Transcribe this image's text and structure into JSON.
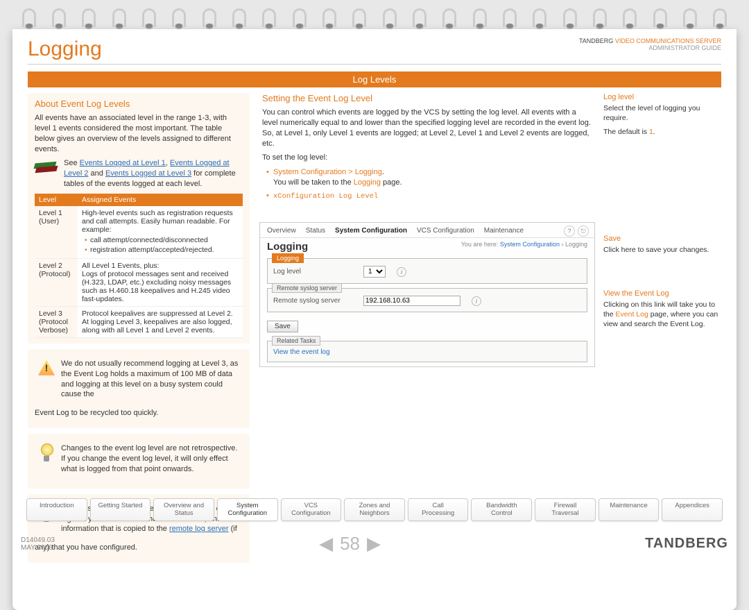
{
  "header": {
    "title": "Logging",
    "brand": "TANDBERG",
    "product": "VIDEO COMMUNICATIONS SERVER",
    "subtitle": "ADMINISTRATOR GUIDE"
  },
  "section_bar": "Log Levels",
  "left": {
    "about_h": "About Event Log Levels",
    "about_p": "All events have an associated level in the range 1-3, with level 1 events considered the most important. The table below gives an overview of the levels assigned to different events.",
    "see_prefix": "See ",
    "see_l1": "Events Logged at Level 1",
    "see_l2": "Events Logged at Level 2",
    "see_and": " and ",
    "see_l3": "Events Logged at Level 3",
    "see_suffix": " for complete tables of the events logged at each level.",
    "table": {
      "h1": "Level",
      "h2": "Assigned Events",
      "r1c1a": "Level 1",
      "r1c1b": "(User)",
      "r1c2": "High-level events such as registration requests and call attempts. Easily human readable. For example:",
      "r1b1": "call attempt/connected/disconnected",
      "r1b2": "registration attempt/accepted/rejected.",
      "r2c1a": "Level 2",
      "r2c1b": "(Protocol)",
      "r2c2a": "All Level 1 Events, plus:",
      "r2c2b": "Logs of protocol messages sent and received (H.323, LDAP, etc.) excluding noisy messages such as H.460.18 keepalives and H.245 video fast-updates.",
      "r3c1a": "Level 3",
      "r3c1b": "(Protocol Verbose)",
      "r3c2": "Protocol keepalives are suppressed at Level 2. At logging Level 3, keepalives are also logged, along with all Level 1 and Level 2 events."
    },
    "warn1a": "We do not usually recommend logging at Level 3, as the Event Log holds a maximum of 100 MB of data and logging at this level on a busy system could cause the",
    "warn1b": "Event Log to be recycled too quickly.",
    "tip1": "Changes to the event log level are not retrospective.  If you change the event log level, it will only effect what is logged from that point onwards.",
    "tip2a": "Changes to the event log level affect both the event log that you can view via the web interface, and the information that is copied to the ",
    "tip2link": "remote log server",
    "tip2b": " (if",
    "tip2c": "any) that you have configured."
  },
  "right": {
    "setting_h": "Setting the Event Log Level",
    "setting_p": "You can control which events are logged by the VCS by setting the log level. All events with a level numerically equal to and lower than the specified logging level are recorded in the event log. So, at Level 1, only Level 1 events are logged; at Level 2, Level 1 and Level 2 events are logged, etc.",
    "toset": "To set the log level:",
    "path1": "System Configuration > Logging",
    "path1b": "You will be taken to the ",
    "path1c": "Logging",
    "path1d": " page.",
    "path2": "xConfiguration Log Level"
  },
  "ss": {
    "tabs": [
      "Overview",
      "Status",
      "System Configuration",
      "VCS Configuration",
      "Maintenance"
    ],
    "active_tab": 2,
    "title": "Logging",
    "crumb_pre": "You are here: ",
    "crumb1": "System Configuration",
    "crumb2": "Logging",
    "fs1": "Logging",
    "f1_label": "Log level",
    "f1_value": "1",
    "fs2": "Remote syslog server",
    "f2_label": "Remote syslog server",
    "f2_value": "192.168.10.63",
    "save": "Save",
    "fs3": "Related Tasks",
    "rt_link": "View the event log"
  },
  "callouts": {
    "c1h": "Log level",
    "c1p1": "Select the level of logging you require.",
    "c1p2a": "The default is ",
    "c1p2b": "1",
    "c1p2c": ".",
    "c2h": "Save",
    "c2p": "Click here to save your changes.",
    "c3h": "View the Event Log",
    "c3p1a": "Clicking on this link will take you to the ",
    "c3p1b": "Event Log",
    "c3p1c": " page, where you can view and search the Event Log."
  },
  "btabs": [
    "Introduction",
    "Getting Started",
    "Overview and\nStatus",
    "System\nConfiguration",
    "VCS\nConfiguration",
    "Zones and\nNeighbors",
    "Call\nProcessing",
    "Bandwidth\nControl",
    "Firewall\nTraversal",
    "Maintenance",
    "Appendices"
  ],
  "btabs_active": 3,
  "footer": {
    "doc": "D14049.03",
    "date": "MAY 2008",
    "page": "58",
    "brand": "TANDBERG"
  }
}
